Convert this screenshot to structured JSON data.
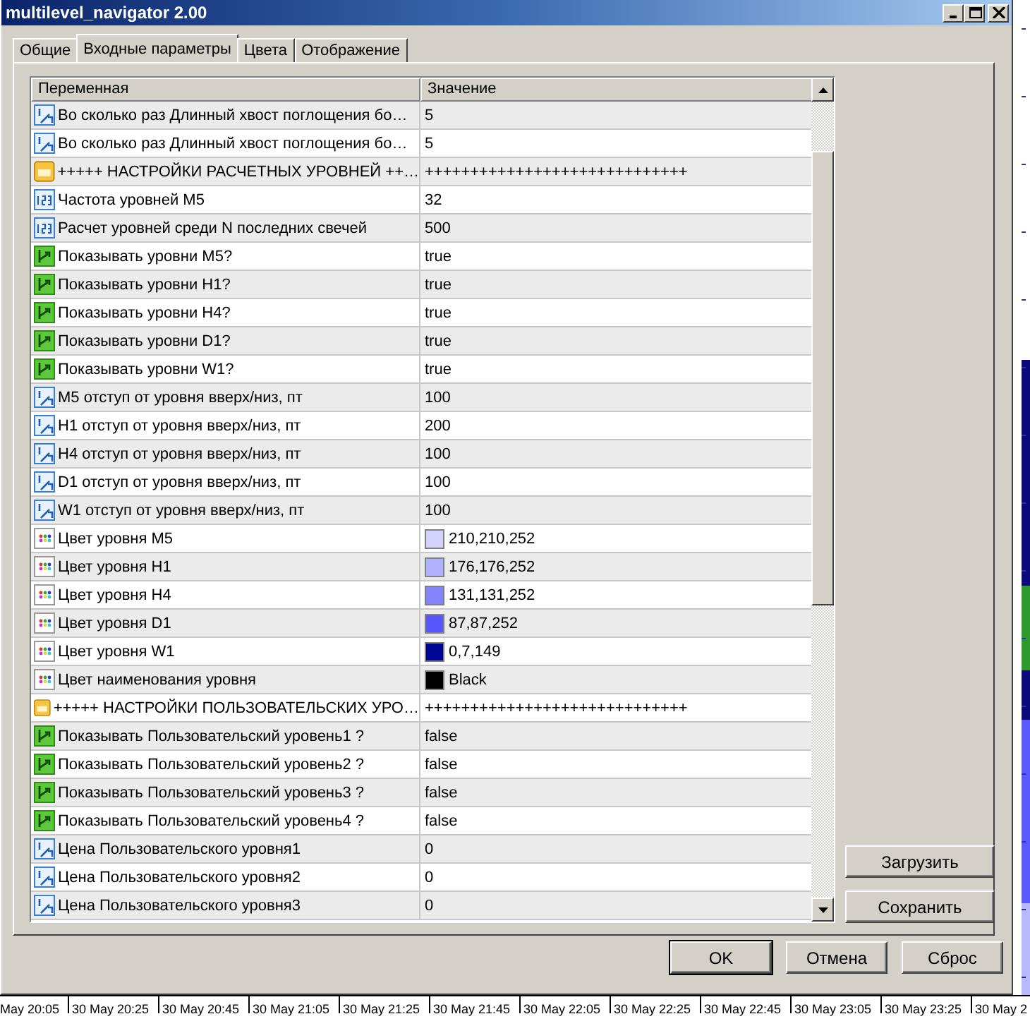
{
  "window": {
    "title": "multilevel_navigator 2.00"
  },
  "tabs": [
    {
      "label": "Общие",
      "selected": false
    },
    {
      "label": "Входные параметры",
      "selected": true
    },
    {
      "label": "Цвета",
      "selected": false
    },
    {
      "label": "Отображение",
      "selected": false
    }
  ],
  "grid": {
    "columns": [
      "Переменная",
      "Значение"
    ],
    "rows": [
      {
        "kind": "double",
        "name": "Во сколько раз Длинный хвост поглощения бо…",
        "value": "5"
      },
      {
        "kind": "double",
        "name": "Во сколько раз Длинный хвост поглощения бо…",
        "value": "5"
      },
      {
        "kind": "string",
        "name": "+++++ НАСТРОЙКИ РАСЧЕТНЫХ УРОВНЕЙ ++…",
        "value": "+++++++++++++++++++++++++++++"
      },
      {
        "kind": "int",
        "name": "Частота уровней M5",
        "value": "32"
      },
      {
        "kind": "int",
        "name": "Расчет уровней среди N последних свечей",
        "value": "500"
      },
      {
        "kind": "bool",
        "name": "Показывать уровни M5?",
        "value": "true"
      },
      {
        "kind": "bool",
        "name": "Показывать уровни H1?",
        "value": "true"
      },
      {
        "kind": "bool",
        "name": "Показывать уровни H4?",
        "value": "true"
      },
      {
        "kind": "bool",
        "name": "Показывать уровни D1?",
        "value": "true"
      },
      {
        "kind": "bool",
        "name": "Показывать уровни W1?",
        "value": "true"
      },
      {
        "kind": "double",
        "name": "M5 отступ от уровня вверх/низ, пт",
        "value": "100"
      },
      {
        "kind": "double",
        "name": "H1 отступ от уровня вверх/низ, пт",
        "value": "200"
      },
      {
        "kind": "double",
        "name": "H4 отступ от уровня вверх/низ, пт",
        "value": "100"
      },
      {
        "kind": "double",
        "name": "D1 отступ от уровня вверх/низ, пт",
        "value": "100"
      },
      {
        "kind": "double",
        "name": "W1 отступ от уровня вверх/низ, пт",
        "value": "100"
      },
      {
        "kind": "color",
        "name": "Цвет уровня M5",
        "value": "210,210,252",
        "color": "#d2d2fc"
      },
      {
        "kind": "color",
        "name": "Цвет уровня H1",
        "value": "176,176,252",
        "color": "#b0b0fc"
      },
      {
        "kind": "color",
        "name": "Цвет уровня H4",
        "value": "131,131,252",
        "color": "#8383fc"
      },
      {
        "kind": "color",
        "name": "Цвет уровня D1",
        "value": "87,87,252",
        "color": "#5757fc"
      },
      {
        "kind": "color",
        "name": "Цвет уровня W1",
        "value": "0,7,149",
        "color": "#000795"
      },
      {
        "kind": "color",
        "name": "Цвет наименования уровня",
        "value": "Black",
        "color": "#000000"
      },
      {
        "kind": "string",
        "name": "+++++ НАСТРОЙКИ ПОЛЬЗОВАТЕЛЬСКИХ УРО…",
        "value": "+++++++++++++++++++++++++++++"
      },
      {
        "kind": "bool",
        "name": "Показывать Пользовательский уровень1 ?",
        "value": "false"
      },
      {
        "kind": "bool",
        "name": "Показывать Пользовательский уровень2 ?",
        "value": "false"
      },
      {
        "kind": "bool",
        "name": "Показывать Пользовательский уровень3 ?",
        "value": "false"
      },
      {
        "kind": "bool",
        "name": "Показывать Пользовательский уровень4 ?",
        "value": "false"
      },
      {
        "kind": "double",
        "name": "Цена Пользовательского уровня1",
        "value": "0"
      },
      {
        "kind": "double",
        "name": "Цена Пользовательского уровня2",
        "value": "0"
      },
      {
        "kind": "double",
        "name": "Цена Пользовательского уровня3",
        "value": "0"
      }
    ]
  },
  "side_buttons": [
    "Загрузить",
    "Сохранить"
  ],
  "buttons": [
    {
      "label": "OK",
      "default": true
    },
    {
      "label": "Отмена",
      "default": false
    },
    {
      "label": "Сброс",
      "default": false
    }
  ],
  "time_axis": {
    "labels": [
      "May 20:05",
      "30 May 20:25",
      "30 May 20:45",
      "30 May 21:05",
      "30 May 21:25",
      "30 May 21:45",
      "30 May 22:05",
      "30 May 22:25",
      "30 May 22:45",
      "30 May 23:05",
      "30 May 23:25",
      "30 May 2"
    ]
  }
}
